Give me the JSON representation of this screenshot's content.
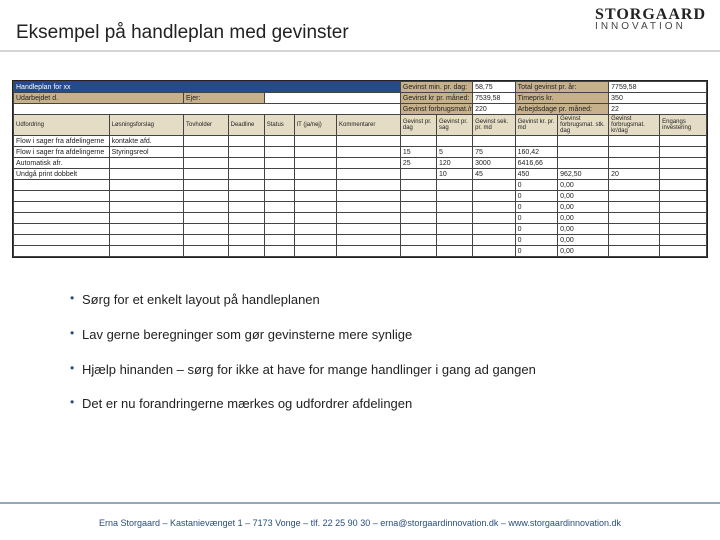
{
  "logo": {
    "top": "STORGAARD",
    "bottom": "INNOVATION"
  },
  "title": "Eksempel på handleplan med gevinster",
  "sheet": {
    "plan_title": "Handleplan for xx",
    "row2_labels": {
      "udarb": "Udarbejdet d.",
      "ejer": "Ejer:"
    },
    "top_metrics": {
      "l1": "Gevinst min. pr. dag:",
      "v1": "58,75",
      "l2": "Gevinst kr pr. måned:",
      "v2": "7539,58",
      "l3": "Gevinst forbrugsmat./mån",
      "v3": "220",
      "r1": "Total gevinst pr. år:",
      "rv1": "7759,58",
      "r2": "Timepris kr.",
      "rv2": "350",
      "r3": "Arbejdsdage pr. måned:",
      "rv3": "22"
    },
    "col_headers": {
      "c1": "Udfordring",
      "c2": "Løsningsforslag",
      "c3": "Tovholder",
      "c4": "Deadline",
      "c5": "Status",
      "c6": "IT (ja/nej)",
      "c7": "Kommentarer",
      "c8": "Gevinst pr. dag",
      "c9": "Gevinst pr. sag",
      "c10": "Gevinst sek. pr. md",
      "c11": "Gevinst kr. pr. md",
      "c12": "Gevinst forbrugsmat. stk. dag",
      "c13": "Gevinst forbrugsmat. kr/dag",
      "c14": "Engangs investering"
    },
    "rows": [
      {
        "c1": "Flow i sager fra afdelingerne",
        "c2": "kontakte afd.",
        "c8": "",
        "c9": "",
        "c10": "",
        "c11": "",
        "c12": "",
        "c13": ""
      },
      {
        "c1": "Flow i sager fra afdelingerne",
        "c2": "Styringsreol",
        "c8": "15",
        "c9": "5",
        "c10": "75",
        "c11": "160,42",
        "c12": "",
        "c13": ""
      },
      {
        "c1": "Automatisk afr.",
        "c2": "",
        "c8": "25",
        "c9": "120",
        "c10": "3000",
        "c11": "6416,66",
        "c12": "",
        "c13": ""
      },
      {
        "c1": "Undgå print dobbelt",
        "c2": "",
        "c8": "",
        "c9": "10",
        "c10": "45",
        "c11": "450",
        "c12": "962,50",
        "c13": "20"
      },
      {
        "c1": "",
        "c8": "",
        "c9": "",
        "c10": "",
        "c11": "0",
        "c12": "0,00",
        "c13": ""
      },
      {
        "c1": "",
        "c8": "",
        "c9": "",
        "c10": "",
        "c11": "0",
        "c12": "0,00",
        "c13": ""
      },
      {
        "c1": "",
        "c8": "",
        "c9": "",
        "c10": "",
        "c11": "0",
        "c12": "0,00",
        "c13": ""
      },
      {
        "c1": "",
        "c8": "",
        "c9": "",
        "c10": "",
        "c11": "0",
        "c12": "0,00",
        "c13": ""
      },
      {
        "c1": "",
        "c8": "",
        "c9": "",
        "c10": "",
        "c11": "0",
        "c12": "0,00",
        "c13": ""
      },
      {
        "c1": "",
        "c8": "",
        "c9": "",
        "c10": "",
        "c11": "0",
        "c12": "0,00",
        "c13": ""
      },
      {
        "c1": "",
        "c8": "",
        "c9": "",
        "c10": "",
        "c11": "0",
        "c12": "0,00",
        "c13": ""
      }
    ]
  },
  "bullets": [
    "Sørg for et enkelt layout på handleplanen",
    "Lav gerne beregninger som gør gevinsterne mere synlige",
    "Hjælp hinanden – sørg for ikke at have for mange handlinger i gang ad gangen",
    "Det er nu forandringerne mærkes og udfordrer afdelingen"
  ],
  "footer": "Erna Storgaard – Kastanievænget 1 – 7173 Vonge – tlf. 22 25 90 30 – erna@storgaardinnovation.dk – www.storgaardinnovation.dk"
}
